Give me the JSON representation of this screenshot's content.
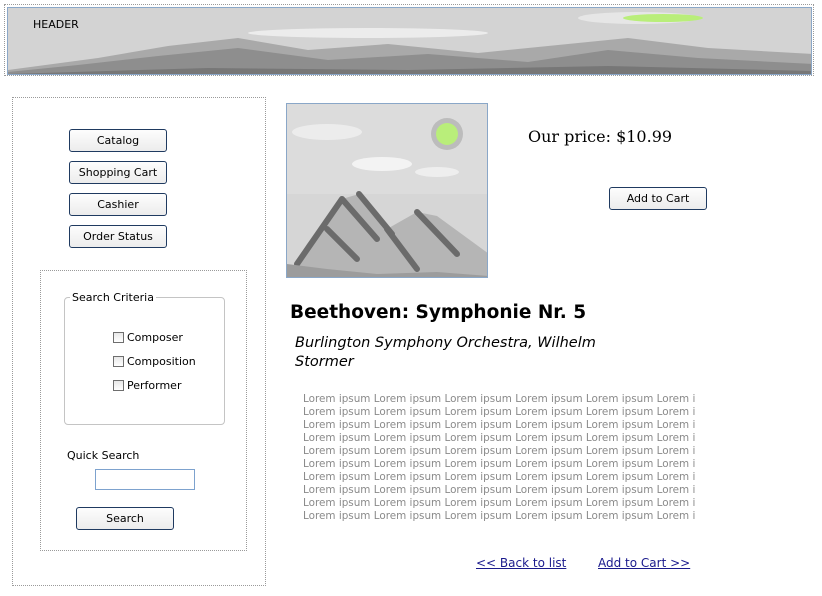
{
  "header": {
    "label": "HEADER"
  },
  "sidebar": {
    "nav": [
      {
        "label": "Catalog"
      },
      {
        "label": "Shopping Cart"
      },
      {
        "label": "Cashier"
      },
      {
        "label": "Order Status"
      }
    ],
    "search": {
      "criteria_title": "Search Criteria",
      "criteria": [
        {
          "label": "Composer",
          "checked": false
        },
        {
          "label": "Composition",
          "checked": false
        },
        {
          "label": "Performer",
          "checked": false
        }
      ],
      "quick_search_label": "Quick Search",
      "quick_search_value": "",
      "button_label": "Search"
    }
  },
  "product": {
    "price_label": "Our price: $10.99",
    "add_to_cart_label": "Add to Cart",
    "title": "Beethoven: Symphonie Nr. 5",
    "artist": "Burlington Symphony Orchestra, Wilhelm Stormer",
    "description_lines": [
      "Lorem ipsum Lorem ipsum Lorem ipsum Lorem ipsum Lorem ipsum Lorem ipsum Lore",
      "Lorem ipsum Lorem ipsum Lorem ipsum Lorem ipsum Lorem ipsum Lorem ipsum Lore",
      "Lorem ipsum Lorem ipsum Lorem ipsum Lorem ipsum Lorem ipsum Lorem ipsum Lore",
      "Lorem ipsum Lorem ipsum Lorem ipsum Lorem ipsum Lorem ipsum Lorem ipsum Lore",
      "Lorem ipsum Lorem ipsum Lorem ipsum Lorem ipsum Lorem ipsum Lorem ipsum Lore",
      "Lorem ipsum Lorem ipsum Lorem ipsum Lorem ipsum Lorem ipsum Lorem ipsum Lore",
      "Lorem ipsum Lorem ipsum Lorem ipsum Lorem ipsum Lorem ipsum Lorem ipsum Lore",
      "Lorem ipsum Lorem ipsum Lorem ipsum Lorem ipsum Lorem ipsum Lorem ipsum Lore",
      "Lorem ipsum Lorem ipsum Lorem ipsum Lorem ipsum Lorem ipsum Lorem ipsum Lore",
      "Lorem ipsum Lorem ipsum Lorem ipsum Lorem ipsum Lorem ipsum Lorem ipsum Lore"
    ]
  },
  "links": {
    "back": "<< Back to list",
    "add_to_cart": "Add to Cart >>"
  },
  "colors": {
    "button_border": "#1f3a60",
    "link": "#1a1a8c",
    "frame_border": "#8aa7c8",
    "description_text": "#8a8a8a"
  }
}
